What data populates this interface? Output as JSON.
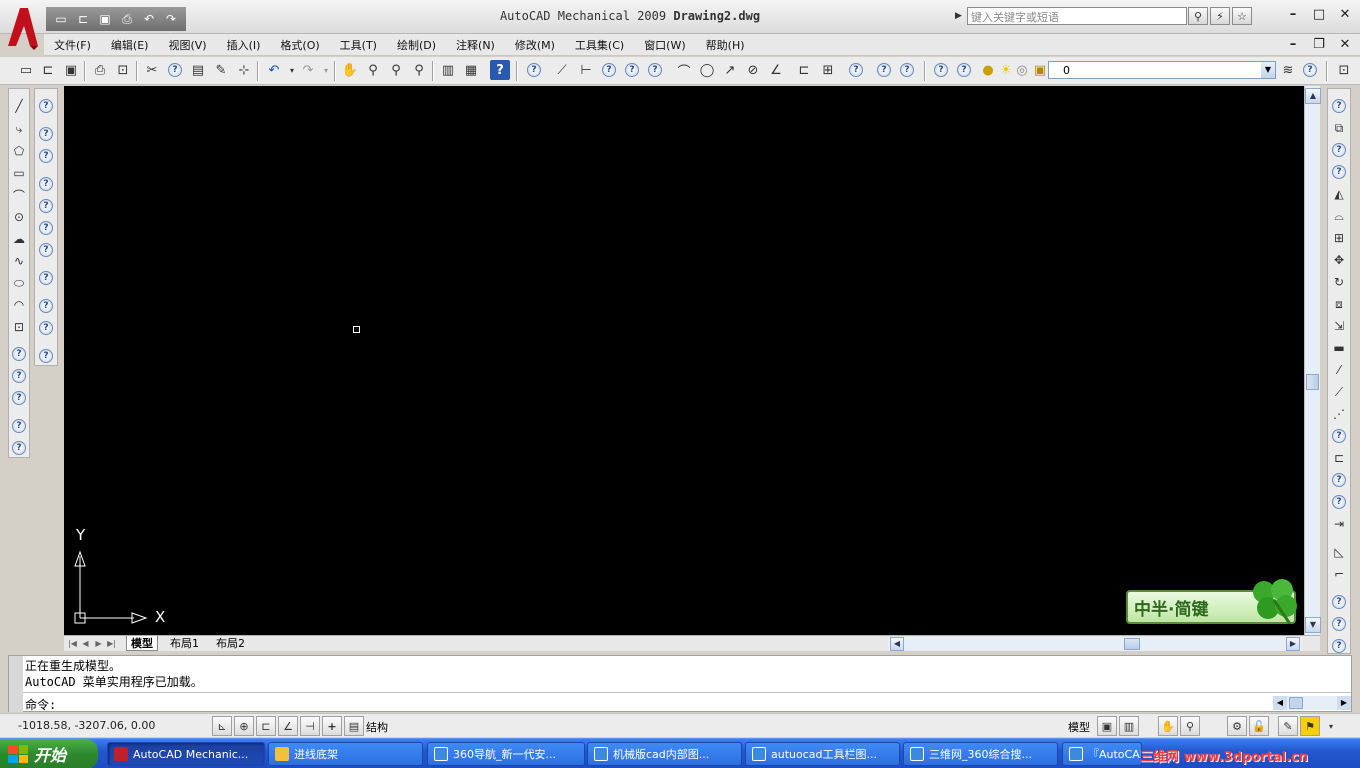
{
  "app": {
    "title_prefix": "AutoCAD Mechanical 2009",
    "title_doc": "Drawing2.dwg",
    "search_placeholder": "键入关键字或短语"
  },
  "menus": [
    "文件(F)",
    "编辑(E)",
    "视图(V)",
    "插入(I)",
    "格式(O)",
    "工具(T)",
    "绘制(D)",
    "注释(N)",
    "修改(M)",
    "工具集(C)",
    "窗口(W)",
    "帮助(H)"
  ],
  "layer": {
    "current": "0"
  },
  "layout_tabs": [
    "模型",
    "布局1",
    "布局2"
  ],
  "axes": {
    "y": "Y",
    "x": "X"
  },
  "ime": {
    "label": "中半·简键"
  },
  "command": {
    "line1": "正在重生成模型。",
    "line2": "AutoCAD 菜单实用程序已加载。",
    "prompt": "命令:"
  },
  "status": {
    "coords": "-1018.58, -3207.06, 0.00",
    "structure": "结构",
    "model": "模型"
  },
  "taskbar": {
    "start": "开始",
    "tasks": [
      {
        "label": "AutoCAD Mechanic...",
        "color": "#c0202a"
      },
      {
        "label": "进线底架",
        "color": "#f0c040"
      },
      {
        "label": "360导航_新一代安...",
        "color": "#3a8ae0"
      },
      {
        "label": "机械版cad内部图...",
        "color": "#3a8ae0"
      },
      {
        "label": "autuocad工具栏图...",
        "color": "#3a8ae0"
      },
      {
        "label": "三维网_360综合搜...",
        "color": "#3a8ae0"
      },
      {
        "label": "『AutoCAD",
        "color": "#3a8ae0"
      }
    ],
    "watermark": "三维网 www.3dportal.cn"
  },
  "colors": {
    "canvas": "#000000",
    "taskbar": "#2458d0",
    "start": "#2d8a2d",
    "accent": "#c0202a"
  }
}
